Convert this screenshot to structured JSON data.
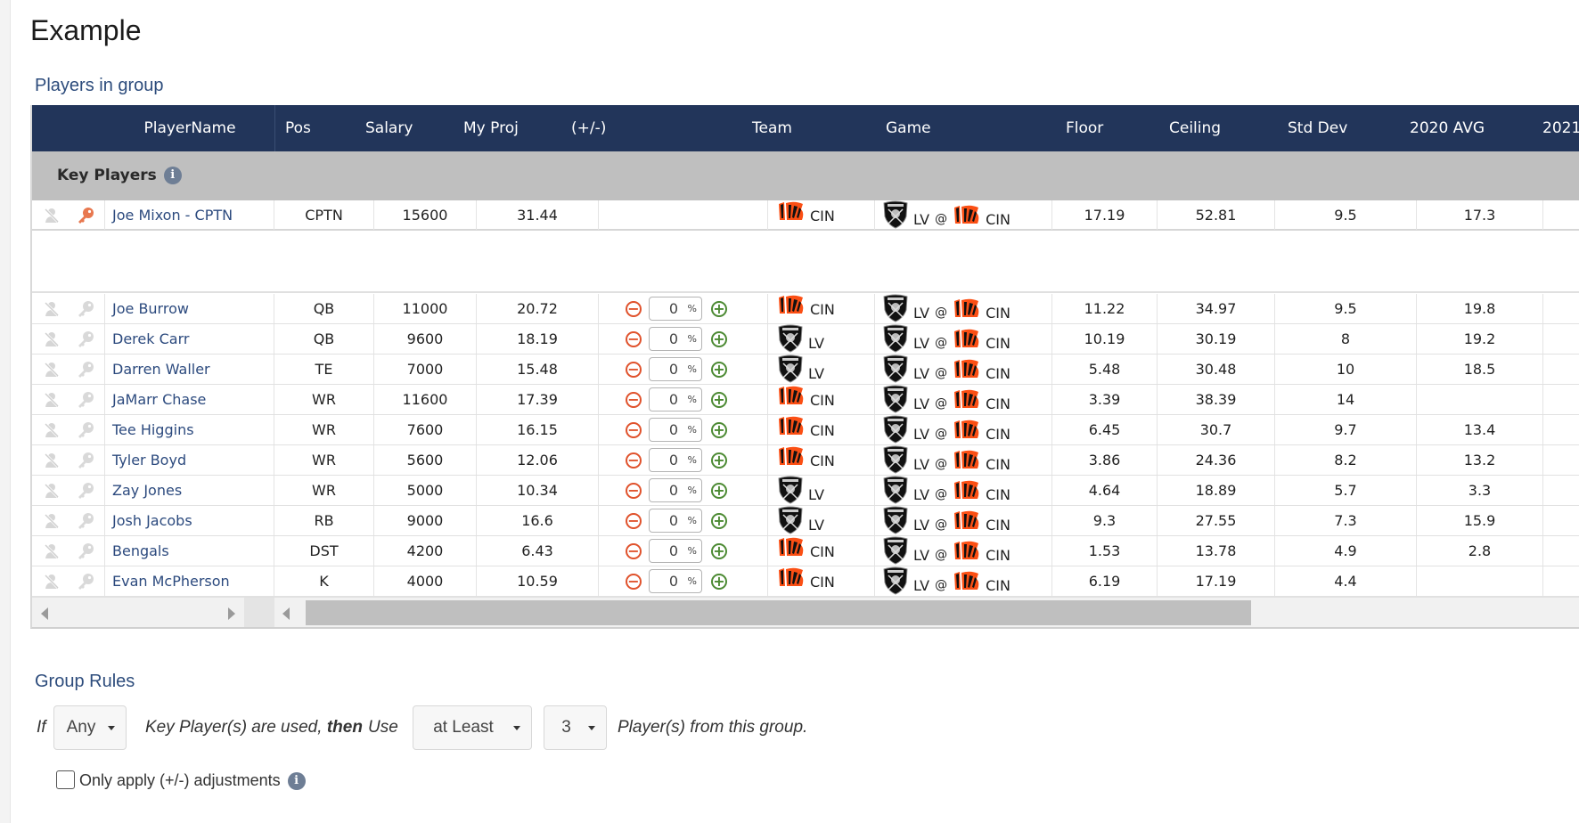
{
  "page": {
    "title": "Example",
    "players_section_title": "Players in group",
    "rules_section_title": "Group Rules"
  },
  "colors": {
    "header_bg": "#22355a",
    "band_bg": "#bfbfbf",
    "name_link": "#2c4a7e",
    "minus": "#e0522c",
    "plus": "#4c8a33",
    "key_active": "#e8784f",
    "bengals_orange": "#fb4f14",
    "raiders_black": "#000000"
  },
  "table": {
    "columns": [
      "",
      "PlayerName",
      "Pos",
      "Salary",
      "My Proj",
      "(+/-)",
      "Team",
      "Game",
      "Floor",
      "Ceiling",
      "Std Dev",
      "2020 AVG",
      "2021"
    ],
    "key_band_label": "Key Players",
    "key_rows": [
      {
        "name": "Joe Mixon - CPTN",
        "pos": "CPTN",
        "salary": "15600",
        "proj": "31.44",
        "adj": null,
        "team": "CIN",
        "team_logo": "bengals-logo",
        "game": {
          "away": "LV",
          "home": "CIN",
          "sep": "@"
        },
        "floor": "17.19",
        "ceiling": "52.81",
        "stddev": "9.5",
        "avg2020": "17.3",
        "avg2021": "",
        "key_active": true
      }
    ],
    "rows": [
      {
        "name": "Joe Burrow",
        "pos": "QB",
        "salary": "11000",
        "proj": "20.72",
        "adj": "0",
        "team": "CIN",
        "team_logo": "bengals-logo",
        "game": {
          "away": "LV",
          "home": "CIN",
          "sep": "@"
        },
        "floor": "11.22",
        "ceiling": "34.97",
        "stddev": "9.5",
        "avg2020": "19.8",
        "avg2021": ""
      },
      {
        "name": "Derek Carr",
        "pos": "QB",
        "salary": "9600",
        "proj": "18.19",
        "adj": "0",
        "team": "LV",
        "team_logo": "raiders-logo",
        "game": {
          "away": "LV",
          "home": "CIN",
          "sep": "@"
        },
        "floor": "10.19",
        "ceiling": "30.19",
        "stddev": "8",
        "avg2020": "19.2",
        "avg2021": ""
      },
      {
        "name": "Darren Waller",
        "pos": "TE",
        "salary": "7000",
        "proj": "15.48",
        "adj": "0",
        "team": "LV",
        "team_logo": "raiders-logo",
        "game": {
          "away": "LV",
          "home": "CIN",
          "sep": "@"
        },
        "floor": "5.48",
        "ceiling": "30.48",
        "stddev": "10",
        "avg2020": "18.5",
        "avg2021": ""
      },
      {
        "name": "JaMarr Chase",
        "pos": "WR",
        "salary": "11600",
        "proj": "17.39",
        "adj": "0",
        "team": "CIN",
        "team_logo": "bengals-logo",
        "game": {
          "away": "LV",
          "home": "CIN",
          "sep": "@"
        },
        "floor": "3.39",
        "ceiling": "38.39",
        "stddev": "14",
        "avg2020": "",
        "avg2021": ""
      },
      {
        "name": "Tee Higgins",
        "pos": "WR",
        "salary": "7600",
        "proj": "16.15",
        "adj": "0",
        "team": "CIN",
        "team_logo": "bengals-logo",
        "game": {
          "away": "LV",
          "home": "CIN",
          "sep": "@"
        },
        "floor": "6.45",
        "ceiling": "30.7",
        "stddev": "9.7",
        "avg2020": "13.4",
        "avg2021": ""
      },
      {
        "name": "Tyler Boyd",
        "pos": "WR",
        "salary": "5600",
        "proj": "12.06",
        "adj": "0",
        "team": "CIN",
        "team_logo": "bengals-logo",
        "game": {
          "away": "LV",
          "home": "CIN",
          "sep": "@"
        },
        "floor": "3.86",
        "ceiling": "24.36",
        "stddev": "8.2",
        "avg2020": "13.2",
        "avg2021": ""
      },
      {
        "name": "Zay Jones",
        "pos": "WR",
        "salary": "5000",
        "proj": "10.34",
        "adj": "0",
        "team": "LV",
        "team_logo": "raiders-logo",
        "game": {
          "away": "LV",
          "home": "CIN",
          "sep": "@"
        },
        "floor": "4.64",
        "ceiling": "18.89",
        "stddev": "5.7",
        "avg2020": "3.3",
        "avg2021": ""
      },
      {
        "name": "Josh Jacobs",
        "pos": "RB",
        "salary": "9000",
        "proj": "16.6",
        "adj": "0",
        "team": "LV",
        "team_logo": "raiders-logo",
        "game": {
          "away": "LV",
          "home": "CIN",
          "sep": "@"
        },
        "floor": "9.3",
        "ceiling": "27.55",
        "stddev": "7.3",
        "avg2020": "15.9",
        "avg2021": ""
      },
      {
        "name": "Bengals",
        "pos": "DST",
        "salary": "4200",
        "proj": "6.43",
        "adj": "0",
        "team": "CIN",
        "team_logo": "bengals-logo",
        "game": {
          "away": "LV",
          "home": "CIN",
          "sep": "@"
        },
        "floor": "1.53",
        "ceiling": "13.78",
        "stddev": "4.9",
        "avg2020": "2.8",
        "avg2021": ""
      },
      {
        "name": "Evan McPherson",
        "pos": "K",
        "salary": "4000",
        "proj": "10.59",
        "adj": "0",
        "team": "CIN",
        "team_logo": "bengals-logo",
        "game": {
          "away": "LV",
          "home": "CIN",
          "sep": "@"
        },
        "floor": "6.19",
        "ceiling": "17.19",
        "stddev": "4.4",
        "avg2020": "",
        "avg2021": ""
      }
    ],
    "adj_unit": "%",
    "hscroll_position": 0
  },
  "rules": {
    "if_label": "If",
    "key_count_select": "Any",
    "mid_text_1": "Key Player(s) are used, ",
    "mid_text_bold": "then",
    "use_label": "Use",
    "comparator_select": "at Least",
    "count_select": "3",
    "end_text": "Player(s) from this group.",
    "only_adjust_label": "Only apply (+/-) adjustments",
    "only_adjust_checked": false
  }
}
